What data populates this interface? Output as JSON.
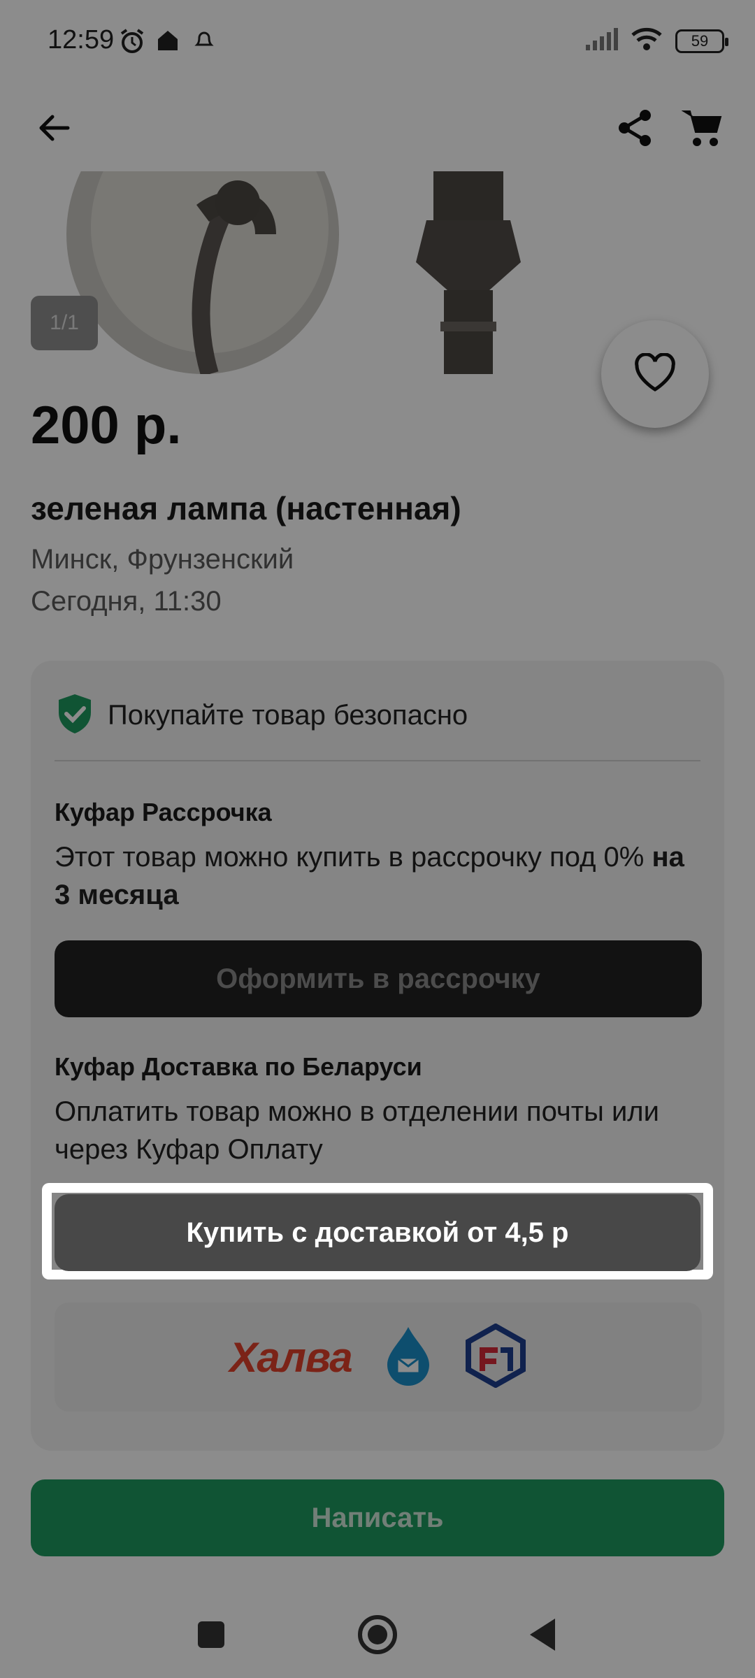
{
  "status_bar": {
    "time": "12:59",
    "battery": "59"
  },
  "header": {
    "back_icon": "arrow-left-icon",
    "share_icon": "share-icon",
    "cart_icon": "cart-icon"
  },
  "gallery": {
    "counter": "1/1"
  },
  "listing": {
    "price": "200 р.",
    "title": "зеленая лампа (настенная)",
    "location": "Минск, Фрунзенский",
    "date": "Сегодня, 11:30"
  },
  "safety": {
    "title": "Покупайте товар безопасно",
    "installment": {
      "heading": "Куфар Рассрочка",
      "text_plain": "Этот товар можно купить в рассрочку под 0% ",
      "text_bold": "на 3 месяца",
      "button": "Оформить в рассрочку"
    },
    "delivery": {
      "heading": "Куфар Доставка по Беларуси",
      "text": "Оплатить товар можно в отделении почты или через Куфар Оплату",
      "button": "Купить с доставкой от 4,5 р"
    },
    "partners": {
      "halva": "Халва"
    }
  },
  "actions": {
    "write": "Написать"
  },
  "colors": {
    "accent_green": "#1e9960",
    "shield_green": "#1e9960",
    "halva_red": "#e0402a"
  }
}
